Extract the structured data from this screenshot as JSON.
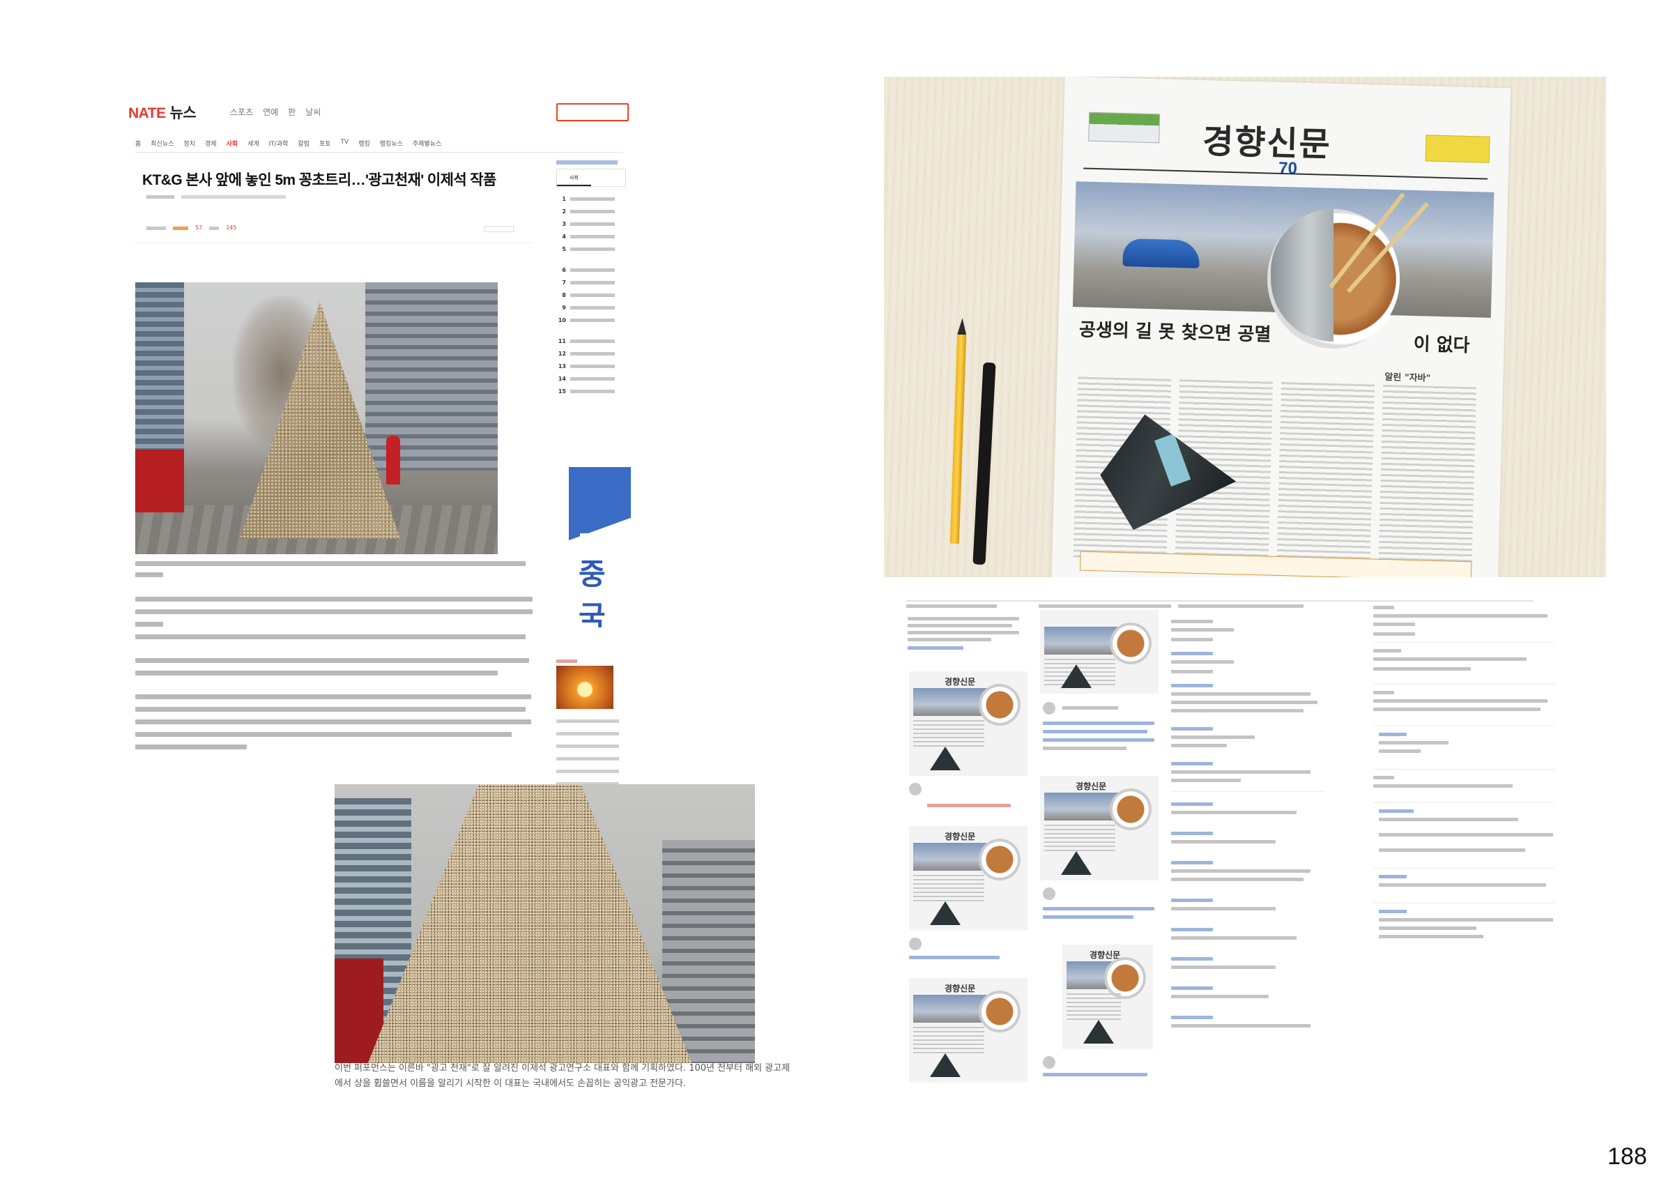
{
  "nate": {
    "logo": "NATE",
    "logo_news": "뉴스",
    "gnb": [
      "스포츠",
      "연예",
      "판",
      "날씨"
    ],
    "subnav": [
      "홈",
      "최신뉴스",
      "정치",
      "경제",
      "사회",
      "세계",
      "IT/과학",
      "칼럼",
      "포토",
      "TV",
      "랭킹",
      "랭킹뉴스",
      "주제별뉴스"
    ],
    "subnav_active": "사회",
    "headline": "KT&G 본사 앞에 놓인 5m 꽁초트리…'광고천재' 이제석 작품",
    "stat_like": "57",
    "stat_comment": "145",
    "ranking_tab": "사회",
    "ranking_numbers": [
      "1",
      "2",
      "3",
      "4",
      "5",
      "6",
      "7",
      "8",
      "9",
      "10",
      "11",
      "12",
      "13",
      "14",
      "15"
    ],
    "ad_text": "중국"
  },
  "cone_photo_caption": "이번 퍼포먼스는 이른바 \"광고 천재\"로 잘 알려진 이제석 광고연구소 대표와 함께 기획하였다. 100년 전부터 해외 광고제에서 상을 휩쓸면서 이름을 알리기 시작한 이 대표는 국내에서도 손꼽히는 공익광고 전문가다.",
  "newspaper": {
    "masthead": "경향신문",
    "anniversary": "70",
    "headline_left": "공생의 길 못 찾으면 공멸",
    "headline_right": "이 없다",
    "subhead": "알린 \"자바\""
  },
  "page_number": "188",
  "colors": {
    "nate_red": "#e8392f",
    "nate_blue": "#4a6fb5"
  }
}
